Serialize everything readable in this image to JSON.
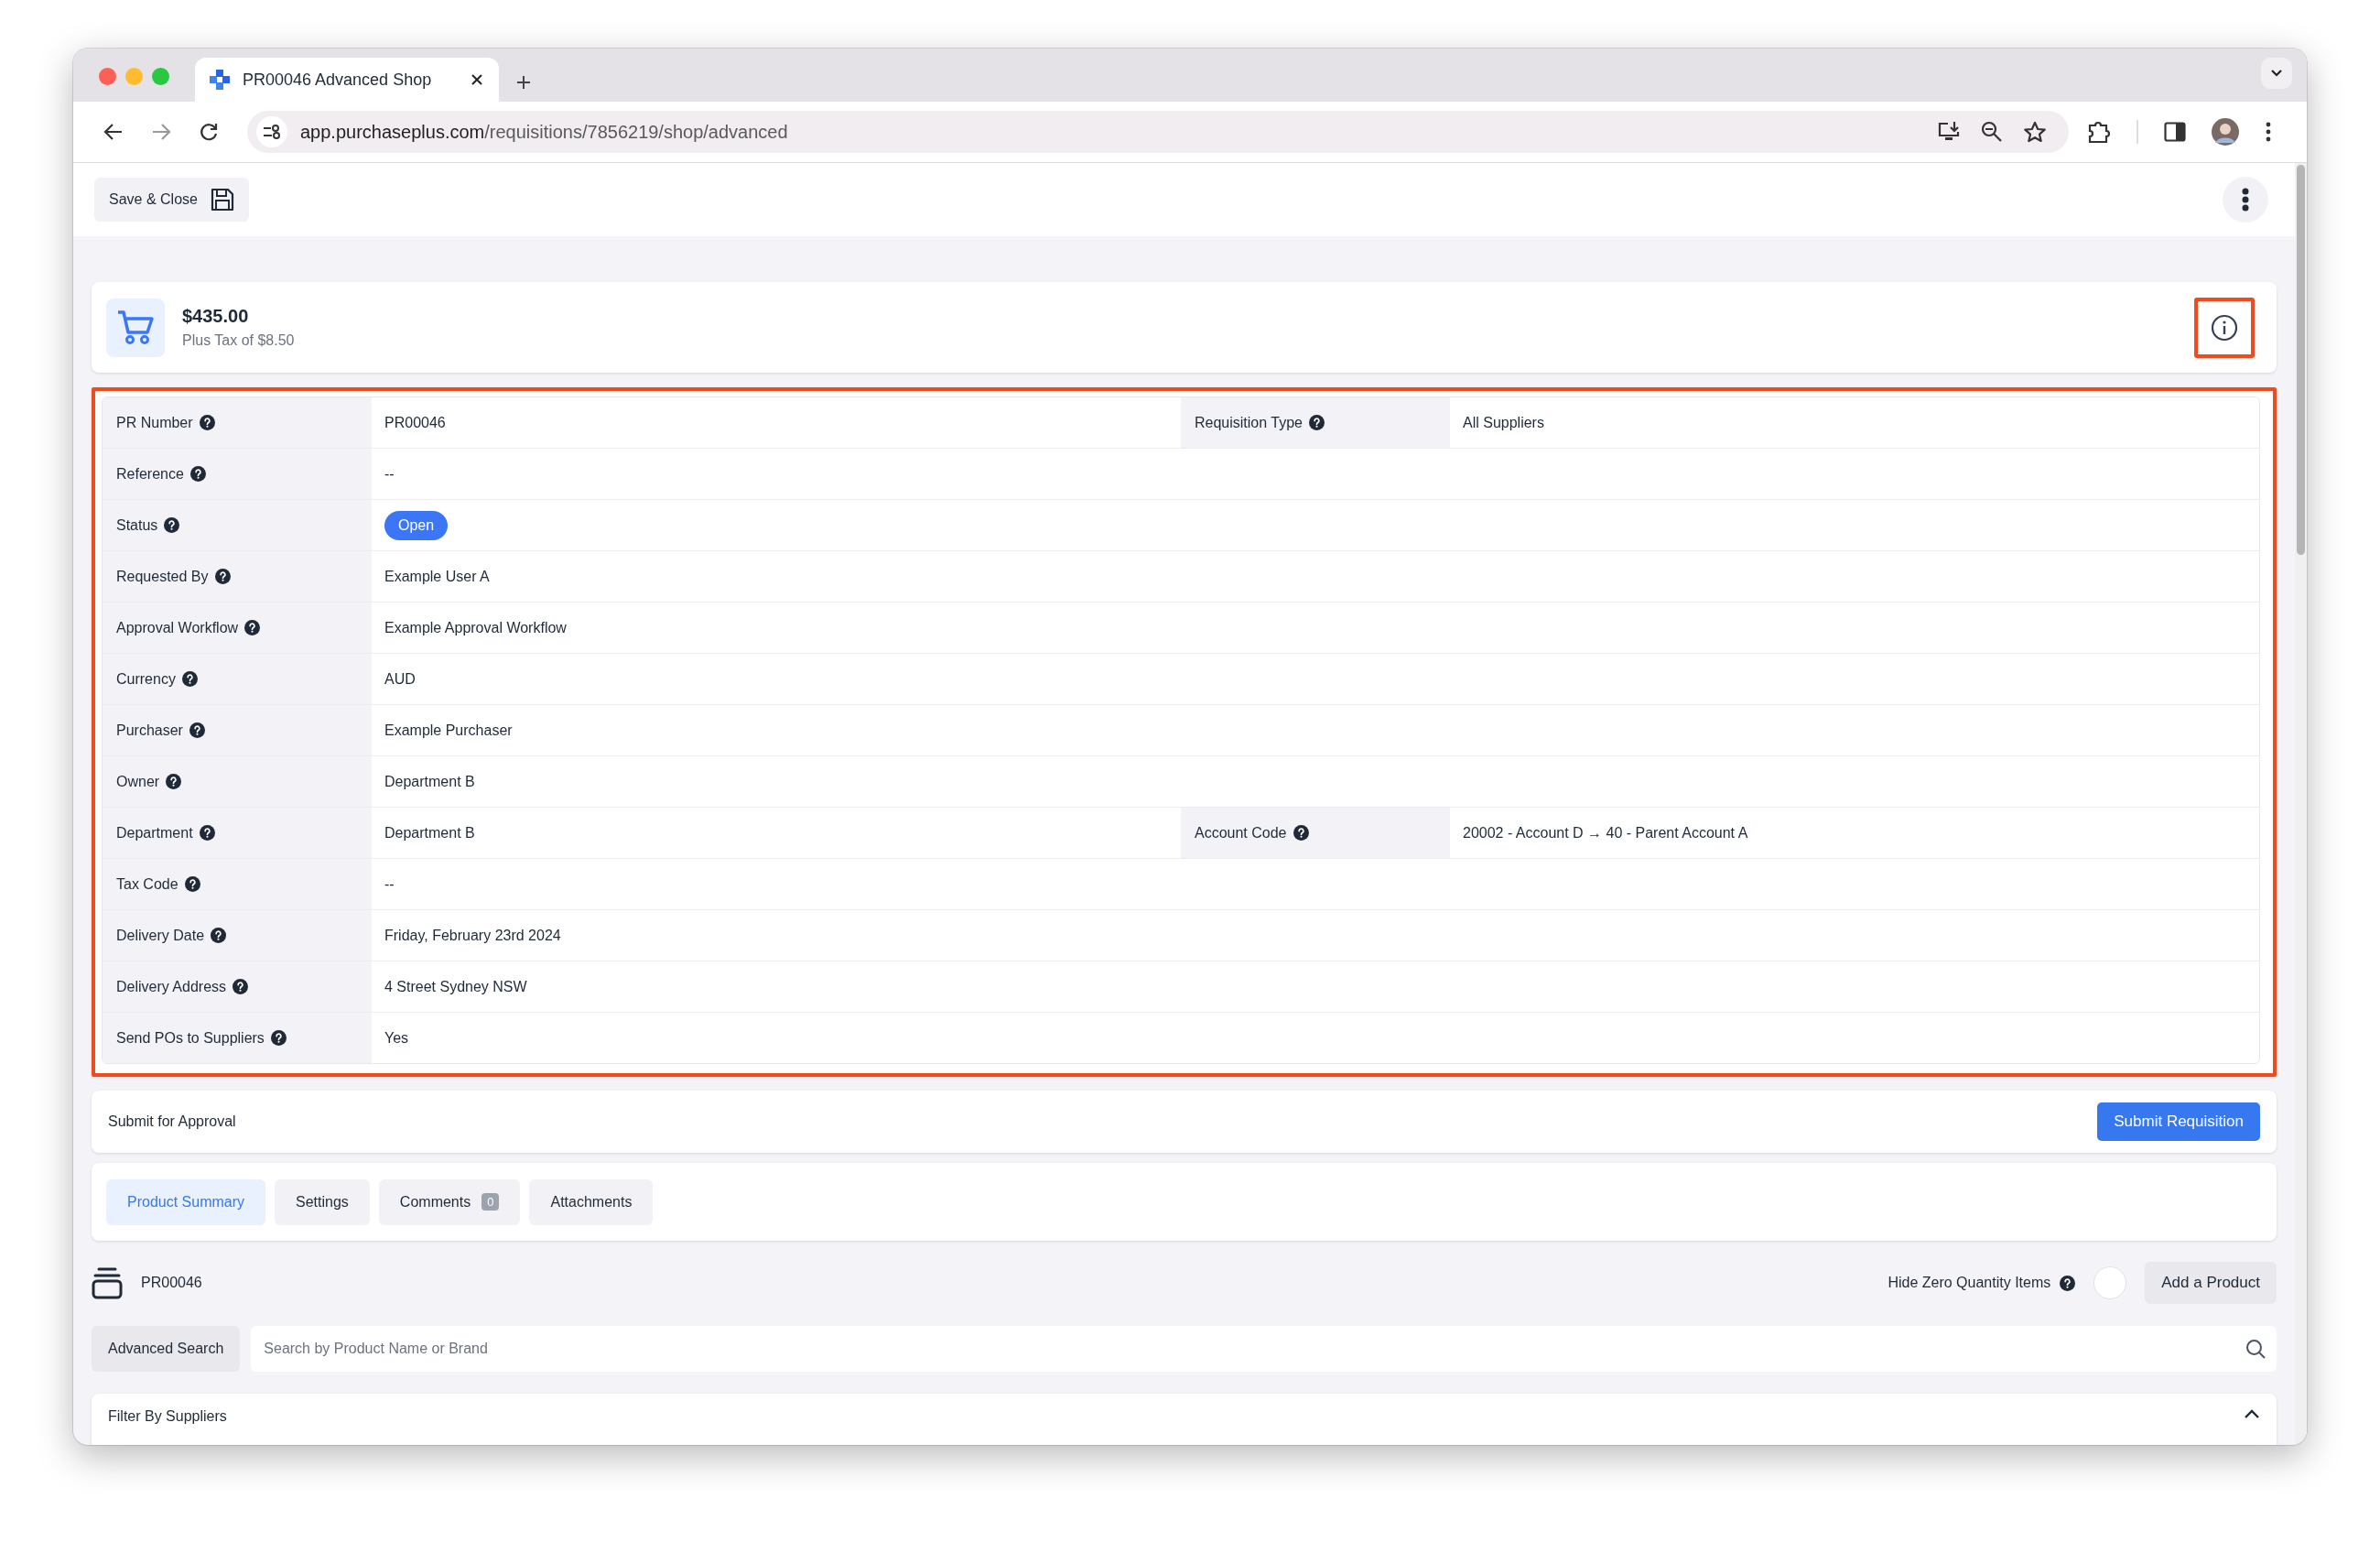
{
  "browser": {
    "tab_title": "PR00046 Advanced Shop",
    "url_host": "app.purchaseplus.com",
    "url_path": "/requisitions/7856219/shop/advanced"
  },
  "top_bar": {
    "save_button": "Save & Close"
  },
  "summary": {
    "total": "$435.00",
    "tax": "Plus Tax of $8.50",
    "info_highlighted": true
  },
  "details": {
    "highlighted": true,
    "rows": [
      {
        "fields": [
          {
            "label": "PR Number",
            "value": "PR00046",
            "kind": "text"
          },
          {
            "label": "Requisition Type",
            "value": "All Suppliers",
            "kind": "text"
          }
        ]
      },
      {
        "fields": [
          {
            "label": "Reference",
            "value": "--",
            "kind": "text"
          }
        ]
      },
      {
        "fields": [
          {
            "label": "Status",
            "value": "Open",
            "kind": "badge"
          }
        ]
      },
      {
        "fields": [
          {
            "label": "Requested By",
            "value": "Example User A",
            "kind": "text"
          }
        ]
      },
      {
        "fields": [
          {
            "label": "Approval Workflow",
            "value": "Example Approval Workflow",
            "kind": "text"
          }
        ]
      },
      {
        "fields": [
          {
            "label": "Currency",
            "value": "AUD",
            "kind": "text"
          }
        ]
      },
      {
        "fields": [
          {
            "label": "Purchaser",
            "value": "Example Purchaser",
            "kind": "text"
          }
        ]
      },
      {
        "fields": [
          {
            "label": "Owner",
            "value": "Department B",
            "kind": "text"
          }
        ]
      },
      {
        "fields": [
          {
            "label": "Department",
            "value": "Department B",
            "kind": "text"
          },
          {
            "label": "Account Code",
            "value": "20002 - Account D → 40 - Parent Account A",
            "kind": "text"
          }
        ]
      },
      {
        "fields": [
          {
            "label": "Tax Code",
            "value": "--",
            "kind": "text"
          }
        ]
      },
      {
        "fields": [
          {
            "label": "Delivery Date",
            "value": "Friday, February 23rd 2024",
            "kind": "text"
          }
        ]
      },
      {
        "fields": [
          {
            "label": "Delivery Address",
            "value": "4 Street Sydney NSW",
            "kind": "text"
          }
        ]
      },
      {
        "fields": [
          {
            "label": "Send POs to Suppliers",
            "value": "Yes",
            "kind": "text"
          }
        ]
      }
    ]
  },
  "submit": {
    "label": "Submit for Approval",
    "button": "Submit Requisition"
  },
  "tabs": [
    {
      "label": "Product Summary",
      "selected": true
    },
    {
      "label": "Settings",
      "selected": false
    },
    {
      "label": "Comments",
      "count": "0",
      "selected": false
    },
    {
      "label": "Attachments",
      "selected": false
    }
  ],
  "products": {
    "title": "PR00046",
    "hide_zero": {
      "label": "Hide Zero Quantity Items",
      "on": false
    },
    "add_button": "Add a Product"
  },
  "search": {
    "button": "Advanced Search",
    "placeholder": "Search by Product Name or Brand"
  },
  "filter": {
    "title": "Filter By Suppliers",
    "expanded": true
  }
}
